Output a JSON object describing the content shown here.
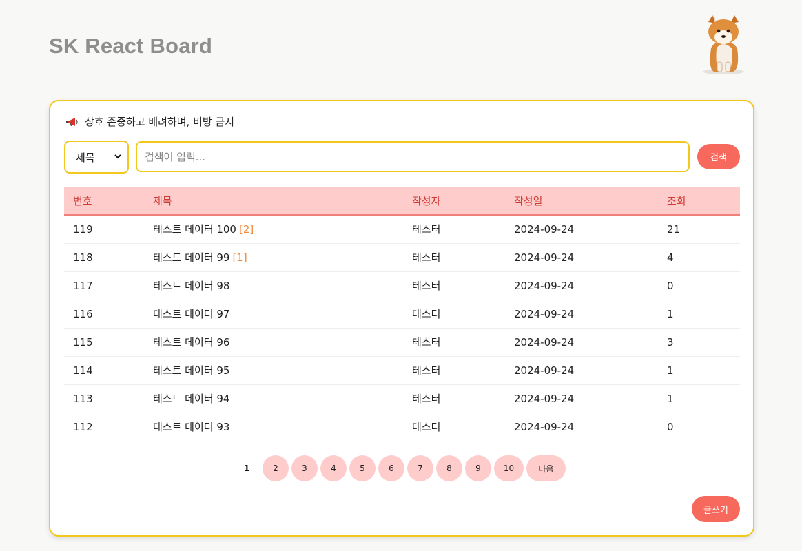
{
  "header": {
    "title": "SK React Board",
    "logo_icon": "shiba-puppy-icon"
  },
  "notice": {
    "icon": "megaphone-icon",
    "text": "상호 존중하고 배려하며, 비방 금지"
  },
  "search": {
    "select_value": "제목",
    "placeholder": "검색어 입력...",
    "button_label": "검색"
  },
  "table": {
    "headers": [
      "번호",
      "제목",
      "작성자",
      "작성일",
      "조회"
    ],
    "rows": [
      {
        "no": "119",
        "title": "테스트 데이터 100",
        "comments": "[2]",
        "author": "테스터",
        "date": "2024-09-24",
        "views": "21"
      },
      {
        "no": "118",
        "title": "테스트 데이터 99",
        "comments": "[1]",
        "author": "테스터",
        "date": "2024-09-24",
        "views": "4"
      },
      {
        "no": "117",
        "title": "테스트 데이터 98",
        "comments": "",
        "author": "테스터",
        "date": "2024-09-24",
        "views": "0"
      },
      {
        "no": "116",
        "title": "테스트 데이터 97",
        "comments": "",
        "author": "테스터",
        "date": "2024-09-24",
        "views": "1"
      },
      {
        "no": "115",
        "title": "테스트 데이터 96",
        "comments": "",
        "author": "테스터",
        "date": "2024-09-24",
        "views": "3"
      },
      {
        "no": "114",
        "title": "테스트 데이터 95",
        "comments": "",
        "author": "테스터",
        "date": "2024-09-24",
        "views": "1"
      },
      {
        "no": "113",
        "title": "테스트 데이터 94",
        "comments": "",
        "author": "테스터",
        "date": "2024-09-24",
        "views": "1"
      },
      {
        "no": "112",
        "title": "테스트 데이터 93",
        "comments": "",
        "author": "테스터",
        "date": "2024-09-24",
        "views": "0"
      }
    ]
  },
  "pagination": {
    "current": "1",
    "pages": [
      "2",
      "3",
      "4",
      "5",
      "6",
      "7",
      "8",
      "9",
      "10"
    ],
    "next_label": "다음"
  },
  "write_button": {
    "label": "글쓰기"
  },
  "colors": {
    "accent_border": "#f2c81d",
    "primary_button": "#f8695d",
    "header_row_bg": "#ffcccc",
    "header_text": "#cd3b34",
    "comment_count": "#f08a3c"
  }
}
